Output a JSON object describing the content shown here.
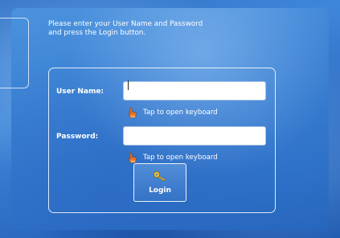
{
  "side_panel": {
    "mark_text": ""
  },
  "instructions": {
    "line1": "Please enter your User Name and Password",
    "line2": "and press the Login button."
  },
  "form": {
    "username": {
      "label": "User Name:",
      "value": "",
      "placeholder": ""
    },
    "password": {
      "label": "Password:",
      "value": "",
      "placeholder": ""
    },
    "keyboard_hint": "Tap to open keyboard",
    "login_label": "Login"
  },
  "icons": {
    "keyboard_hint_icon": "pointing-hand-icon",
    "login_icon": "key-icon"
  },
  "colors": {
    "background": "#3a80d3",
    "text": "#ffffff",
    "hand": "#e8742a",
    "key": "#e6c23a"
  }
}
